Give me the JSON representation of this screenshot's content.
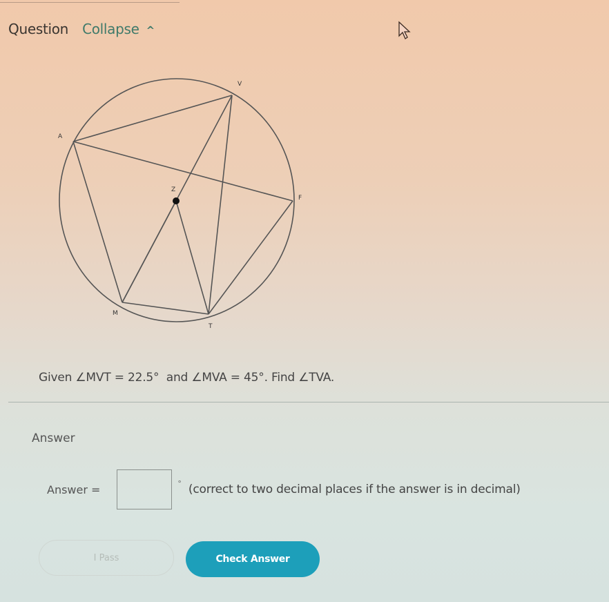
{
  "header": {
    "title": "Question",
    "collapse_label": "Collapse",
    "collapse_icon": "caret-up-icon",
    "caret_glyph": "^"
  },
  "diagram": {
    "center_label": "Z",
    "points": [
      {
        "id": "V",
        "label": "V"
      },
      {
        "id": "A",
        "label": "A"
      },
      {
        "id": "F",
        "label": "F"
      },
      {
        "id": "M",
        "label": "M"
      },
      {
        "id": "T",
        "label": "T"
      }
    ],
    "segments": [
      [
        "A",
        "V"
      ],
      [
        "A",
        "F"
      ],
      [
        "A",
        "M"
      ],
      [
        "V",
        "M"
      ],
      [
        "V",
        "T"
      ],
      [
        "Z",
        "M"
      ],
      [
        "Z",
        "T"
      ],
      [
        "M",
        "T"
      ],
      [
        "T",
        "F"
      ]
    ]
  },
  "question": {
    "text": "Given ∠MVT = 22.5°  and ∠MVA = 45°. Find ∠TVA."
  },
  "answer": {
    "heading": "Answer",
    "label": "Answer =",
    "input_value": "",
    "input_placeholder": "",
    "unit": "°",
    "hint": "(correct to two decimal places if the answer is in decimal)"
  },
  "buttons": {
    "pass_label": "I Pass",
    "check_label": "Check Answer"
  },
  "colors": {
    "accent": "#1d9fba",
    "collapse_link": "#3f7a6a"
  }
}
